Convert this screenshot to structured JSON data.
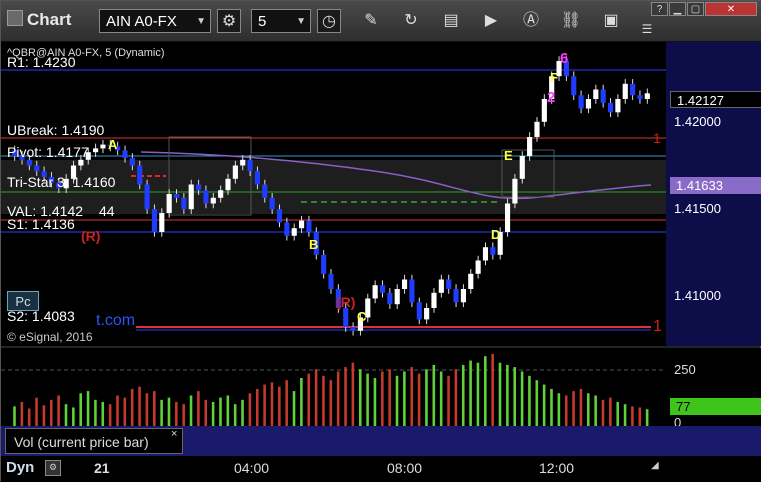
{
  "toolbar": {
    "title": "Chart",
    "symbol": "AIN A0-FX",
    "interval": "5"
  },
  "chart": {
    "header": "^QBR@AIN A0-FX, 5 (Dynamic)",
    "copyright": "© eSignal, 2016",
    "watermark": "t.com",
    "pc_label": "Pc",
    "levels": {
      "r1": "R1: 1.4230",
      "ubreak": "UBreak: 1.4190",
      "pivot": "Pivot: 1.4177",
      "tristar": "Tri-Star 3: 1.4160",
      "val": "VAL: 1.4142",
      "val_extra": "44",
      "s1": "S1: 1.4136",
      "s2": "S2: 1.4083"
    },
    "annotations": {
      "a": "A",
      "b": "B",
      "c": "C",
      "d": "D",
      "e": "E",
      "f": "F",
      "r1": "(R)",
      "r2": "(R)",
      "magenta_top": "6",
      "magenta_2": "2",
      "red_1a": "1",
      "red_1b": "1"
    },
    "axis": {
      "last_price": "1.42127",
      "tag_price": "1.41633",
      "ticks": [
        "1.42000",
        "1.41500",
        "1.41000"
      ]
    },
    "volume": {
      "label": "Vol (current price bar)",
      "close_glyph": "×",
      "ticks": [
        "250",
        "0"
      ],
      "current": "77"
    },
    "time_axis": {
      "dyn_label": "Dyn",
      "labels": [
        "21",
        "04:00",
        "08:00",
        "12:00"
      ]
    }
  },
  "chart_data": {
    "type": "candlestick",
    "price_min": 1.408,
    "price_max": 1.424,
    "closes": [
      1.418,
      1.4178,
      1.4175,
      1.4172,
      1.4169,
      1.4166,
      1.4163,
      1.4168,
      1.4175,
      1.4178,
      1.4182,
      1.4184,
      1.4186,
      1.4185,
      1.4183,
      1.4179,
      1.4175,
      1.4165,
      1.4152,
      1.414,
      1.415,
      1.416,
      1.4158,
      1.4152,
      1.4165,
      1.4162,
      1.4155,
      1.4158,
      1.4162,
      1.4168,
      1.4175,
      1.4178,
      1.4172,
      1.4165,
      1.4158,
      1.4152,
      1.4145,
      1.4138,
      1.4142,
      1.4146,
      1.414,
      1.4128,
      1.4118,
      1.411,
      1.41,
      1.409,
      1.4088,
      1.4095,
      1.4105,
      1.4112,
      1.4108,
      1.4102,
      1.411,
      1.4115,
      1.4103,
      1.4094,
      1.41,
      1.4108,
      1.4115,
      1.411,
      1.4103,
      1.411,
      1.4118,
      1.4125,
      1.4132,
      1.4128,
      1.414,
      1.4155,
      1.4168,
      1.418,
      1.419,
      1.4198,
      1.421,
      1.4222,
      1.423,
      1.4222,
      1.4212,
      1.4205,
      1.421,
      1.4215,
      1.4208,
      1.4203,
      1.421,
      1.4218,
      1.4212,
      1.421,
      1.4213
    ],
    "volumes": [
      90,
      110,
      80,
      130,
      95,
      120,
      140,
      100,
      85,
      150,
      160,
      120,
      110,
      100,
      140,
      130,
      170,
      180,
      150,
      160,
      120,
      130,
      110,
      100,
      140,
      160,
      120,
      110,
      130,
      140,
      100,
      120,
      150,
      170,
      190,
      200,
      180,
      210,
      160,
      220,
      240,
      260,
      230,
      210,
      250,
      270,
      290,
      260,
      240,
      220,
      250,
      260,
      230,
      250,
      270,
      240,
      260,
      280,
      250,
      230,
      260,
      280,
      300,
      290,
      320,
      330,
      290,
      280,
      270,
      250,
      230,
      210,
      190,
      170,
      150,
      140,
      160,
      170,
      150,
      140,
      120,
      130,
      110,
      100,
      90,
      85,
      77
    ]
  }
}
